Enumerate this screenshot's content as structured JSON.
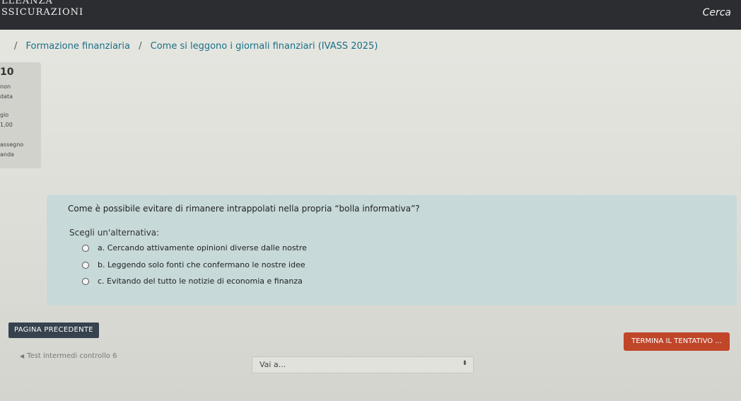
{
  "header": {
    "brand_line1": "LLEANZA",
    "brand_line2": "SSICURAZIONI",
    "search_label": "Cerca"
  },
  "breadcrumb": {
    "separator": "/",
    "items": [
      "Formazione finanziaria",
      "Come si leggono i giornali finanziari (IVASS 2025)"
    ]
  },
  "question_info": {
    "number": "10",
    "state_line1": "non",
    "state_line2": "data",
    "mark_line1": "gio",
    "mark_line2": "1,00",
    "flag_line1": "assegno",
    "flag_line2": "anda"
  },
  "question": {
    "text": "Come è possibile evitare di rimanere intrappolati nella propria “bolla informativa”?",
    "prompt": "Scegli un'alternativa:",
    "options": [
      "a. Cercando attivamente opinioni diverse dalle nostre",
      "b. Leggendo solo fonti che confermano le nostre idee",
      "c. Evitando del tutto le notizie di economia e finanza"
    ]
  },
  "navigation": {
    "previous_page": "PAGINA PRECEDENTE",
    "finish_attempt": "TERMINA IL TENTATIVO ...",
    "activity_link": "Test intermedi controllo 6",
    "jump_to": "Vai a..."
  },
  "colors": {
    "topbar": "#2b2d31",
    "link": "#1a6f85",
    "question_bg": "#c7d9d9",
    "primary_button": "#36424e",
    "finish_button": "#c0462a"
  }
}
